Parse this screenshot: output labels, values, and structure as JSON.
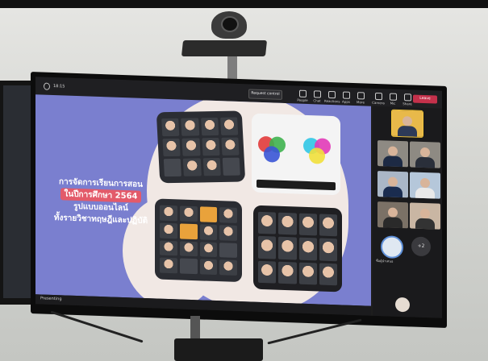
{
  "toolbar": {
    "timer": "18:15",
    "request_control": "Request control",
    "items": [
      "People",
      "Chat",
      "Reactions",
      "Apps",
      "More",
      "Camera",
      "Mic",
      "Share"
    ],
    "leave": "Leave"
  },
  "slide": {
    "line1": "การจัดการเรียนการสอน",
    "line2": "ในปีการศึกษา 2564",
    "line3": "รูปแบบออนไลน์",
    "line4": "ทั้งรายวิชาทฤษฎีและปฏิบัติ"
  },
  "participants": {
    "overflow_count": "+2",
    "presenter_name_short": "ชื่อผู้นำเสนอ"
  },
  "status": {
    "presenter_label": "Presenting"
  },
  "colors": {
    "slide_bg": "#7a7fcf",
    "leave": "#c4314b",
    "highlight": "#e35a6a"
  }
}
